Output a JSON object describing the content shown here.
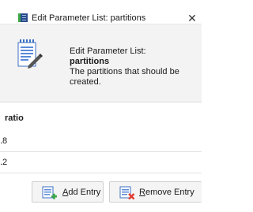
{
  "window": {
    "title": "Edit Parameter List: partitions",
    "close_glyph": "✕"
  },
  "header": {
    "icon": "document-edit-icon",
    "line1": "Edit Parameter List:",
    "line2": "partitions",
    "line3": "The partitions that should be",
    "line4": "created."
  },
  "table": {
    "column_header": "ratio",
    "rows": [
      {
        "ratio": ".8"
      },
      {
        "ratio": ".2"
      }
    ]
  },
  "buttons": {
    "add": {
      "mnemonic": "A",
      "rest": "dd Entry",
      "icon": "add-entry-icon"
    },
    "remove": {
      "mnemonic": "R",
      "rest": "emove Entry",
      "icon": "remove-entry-icon"
    }
  },
  "colors": {
    "header_bg": "#f3f3f3",
    "add_accent": "#3aa845",
    "remove_accent": "#e03a2f",
    "doc_blue": "#3b6fc4"
  }
}
